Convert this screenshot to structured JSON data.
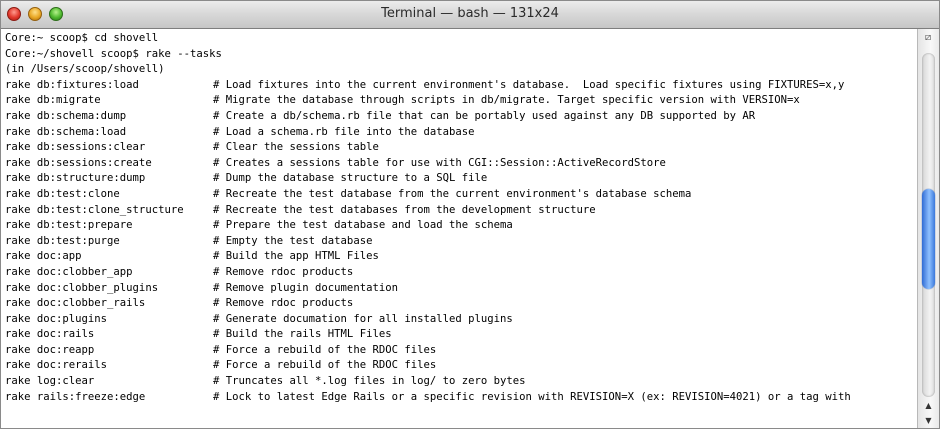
{
  "window": {
    "title": "Terminal — bash — 131x24"
  },
  "terminal": {
    "commands": [
      "Core:~ scoop$ cd shovell",
      "Core:~/shovell scoop$ rake --tasks",
      "(in /Users/scoop/shovell)"
    ],
    "tasks": [
      {
        "task": "rake db:fixtures:load",
        "desc": "# Load fixtures into the current environment's database.  Load specific fixtures using FIXTURES=x,y"
      },
      {
        "task": "rake db:migrate",
        "desc": "# Migrate the database through scripts in db/migrate. Target specific version with VERSION=x"
      },
      {
        "task": "rake db:schema:dump",
        "desc": "# Create a db/schema.rb file that can be portably used against any DB supported by AR"
      },
      {
        "task": "rake db:schema:load",
        "desc": "# Load a schema.rb file into the database"
      },
      {
        "task": "rake db:sessions:clear",
        "desc": "# Clear the sessions table"
      },
      {
        "task": "rake db:sessions:create",
        "desc": "# Creates a sessions table for use with CGI::Session::ActiveRecordStore"
      },
      {
        "task": "rake db:structure:dump",
        "desc": "# Dump the database structure to a SQL file"
      },
      {
        "task": "rake db:test:clone",
        "desc": "# Recreate the test database from the current environment's database schema"
      },
      {
        "task": "rake db:test:clone_structure",
        "desc": "# Recreate the test databases from the development structure"
      },
      {
        "task": "rake db:test:prepare",
        "desc": "# Prepare the test database and load the schema"
      },
      {
        "task": "rake db:test:purge",
        "desc": "# Empty the test database"
      },
      {
        "task": "rake doc:app",
        "desc": "# Build the app HTML Files"
      },
      {
        "task": "rake doc:clobber_app",
        "desc": "# Remove rdoc products"
      },
      {
        "task": "rake doc:clobber_plugins",
        "desc": "# Remove plugin documentation"
      },
      {
        "task": "rake doc:clobber_rails",
        "desc": "# Remove rdoc products"
      },
      {
        "task": "rake doc:plugins",
        "desc": "# Generate documation for all installed plugins"
      },
      {
        "task": "rake doc:rails",
        "desc": "# Build the rails HTML Files"
      },
      {
        "task": "rake doc:reapp",
        "desc": "# Force a rebuild of the RDOC files"
      },
      {
        "task": "rake doc:rerails",
        "desc": "# Force a rebuild of the RDOC files"
      },
      {
        "task": "rake log:clear",
        "desc": "# Truncates all *.log files in log/ to zero bytes"
      },
      {
        "task": "rake rails:freeze:edge",
        "desc": "# Lock to latest Edge Rails or a specific revision with REVISION=X (ex: REVISION=4021) or a tag with"
      }
    ]
  },
  "scrollbar": {
    "split_icon": "split-pane-icon",
    "up_arrow": "▲",
    "down_arrow": "▼",
    "position_fraction": 0.55
  }
}
